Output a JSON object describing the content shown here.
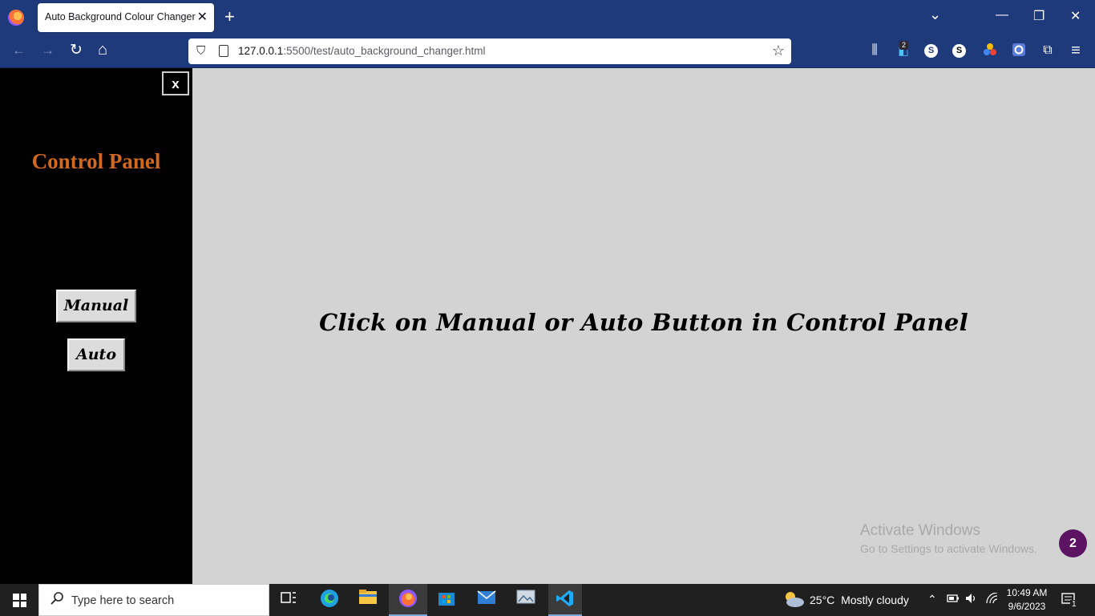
{
  "browser": {
    "tab_title": "Auto Background Colour Changer",
    "tab_close": "✕",
    "new_tab": "+",
    "url_host": "127.0.0.1",
    "url_rest": ":5500/test/auto_background_changer.html",
    "ext_badge_count": "2",
    "ext_s_label": "S",
    "window_controls": {
      "list_all_tabs": "⌄",
      "minimize": "—",
      "restore": "❐",
      "close": "✕"
    },
    "nav": {
      "back": "←",
      "forward": "→",
      "reload": "↻",
      "home": "⌂",
      "shield": "⛉",
      "star": "☆"
    },
    "toolbar_icons": {
      "library": "⫼",
      "extensions": "⧉",
      "menu": "≡"
    }
  },
  "page": {
    "close_label": "x",
    "panel_title": "Control Panel",
    "manual_label": "Manual",
    "auto_label": "Auto",
    "message": "Click on Manual or Auto Button in Control Panel",
    "colors": {
      "panel_title": "#d2691e",
      "sidebar_bg": "#000000",
      "main_bg": "#d3d3d3"
    }
  },
  "overlay": {
    "activate_title": "Activate Windows",
    "activate_sub": "Go to Settings to activate Windows.",
    "badge_count": "2"
  },
  "taskbar": {
    "search_placeholder": "Type here to search",
    "weather_temp": "25°C",
    "weather_desc": "Mostly cloudy",
    "time": "10:49 AM",
    "date": "9/6/2023",
    "notification_count": "1",
    "icons": [
      "task-view",
      "edge",
      "file-explorer",
      "firefox",
      "microsoft-store",
      "mail",
      "photos",
      "vscode"
    ]
  }
}
